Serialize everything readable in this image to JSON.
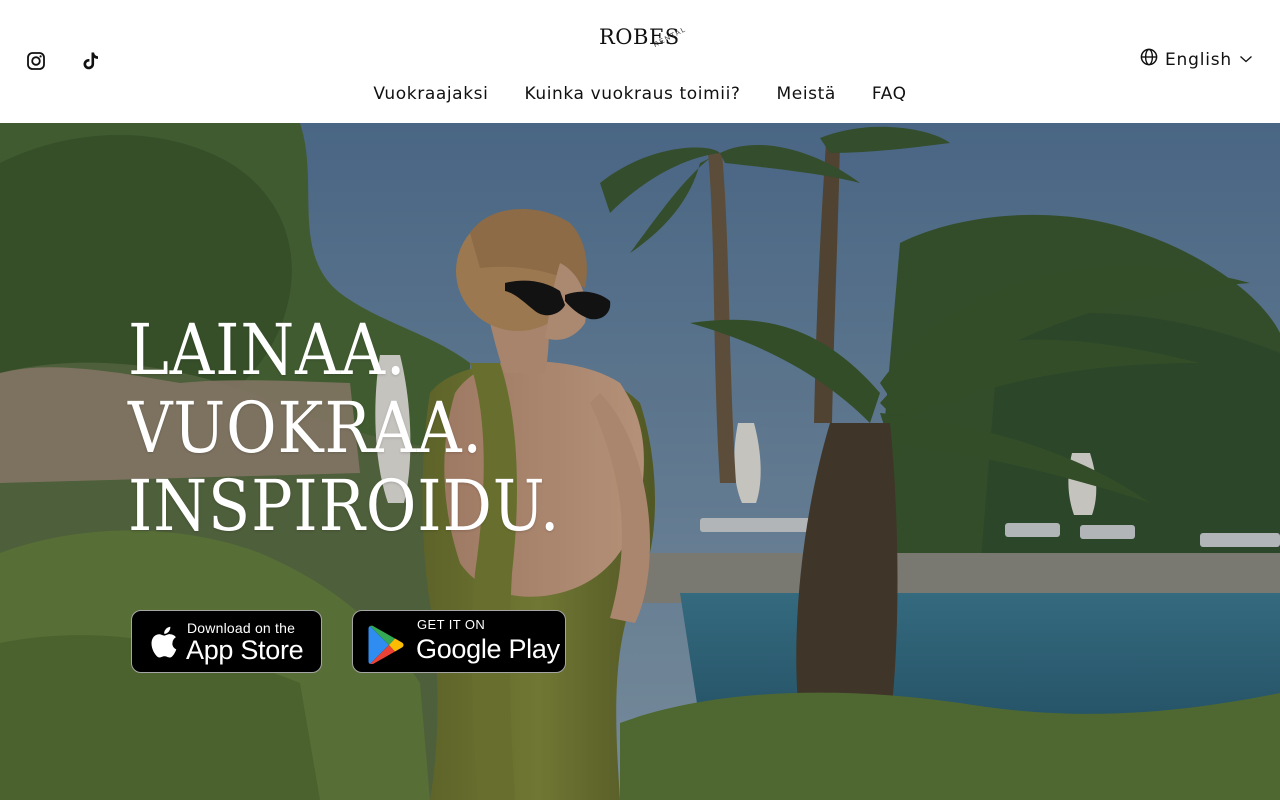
{
  "brand": {
    "name": "ROBES",
    "sub": "RENTAL"
  },
  "social": [
    {
      "icon": "instagram-icon"
    },
    {
      "icon": "tiktok-icon"
    }
  ],
  "nav": {
    "items": [
      {
        "label": "Vuokraajaksi"
      },
      {
        "label": "Kuinka vuokraus toimii?"
      },
      {
        "label": "Meistä"
      },
      {
        "label": "FAQ"
      }
    ]
  },
  "language": {
    "label": "English",
    "icon": "globe-icon",
    "chevron": "chevron-down-icon"
  },
  "hero": {
    "lines": [
      "LAINAA.",
      "VUOKRAA.",
      "INSPIROIDU."
    ],
    "app_store": {
      "small": "Download on the",
      "big": "App Store",
      "icon": "apple-icon"
    },
    "google_play": {
      "small": "GET IT ON",
      "big": "Google Play",
      "icon": "google-play-icon"
    }
  },
  "colors": {
    "text": "#111111",
    "hero_text": "#ffffff",
    "button_bg": "#000000"
  }
}
